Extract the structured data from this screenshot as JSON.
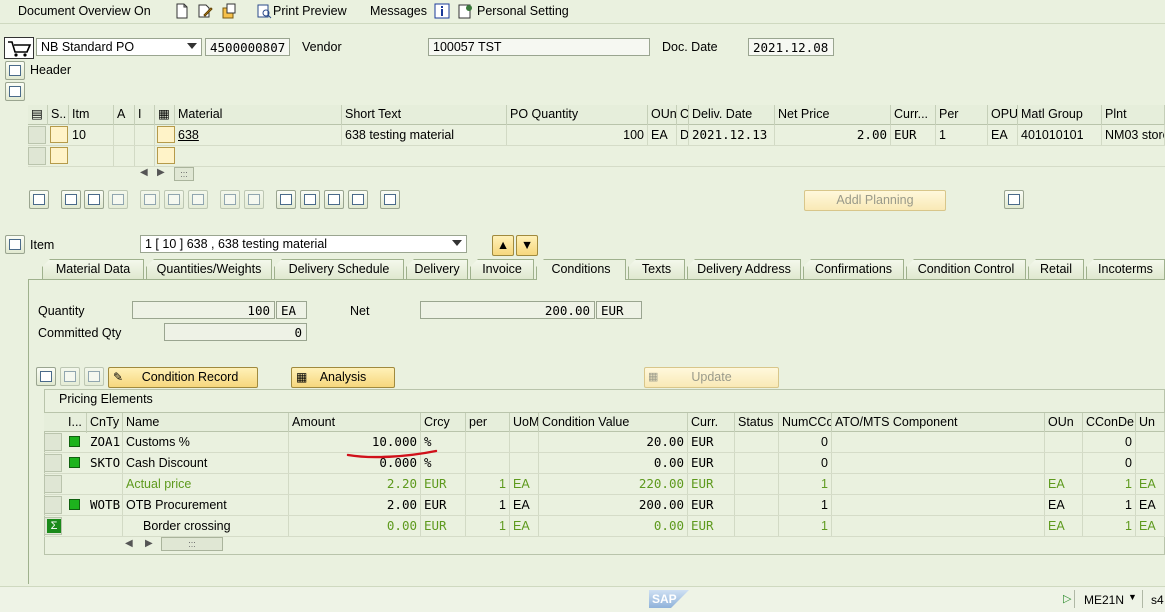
{
  "toolbar": {
    "doc_overview": "Document Overview On",
    "print_preview": "Print Preview",
    "messages": "Messages",
    "personal_setting": "Personal Setting"
  },
  "header": {
    "po_type": "NB Standard PO",
    "po_number": "4500000807",
    "vendor_label": "Vendor",
    "vendor_value": "100057 TST",
    "doc_date_label": "Doc. Date",
    "doc_date_value": "2021.12.08",
    "header_label": "Header"
  },
  "item_grid": {
    "columns": [
      "S..",
      "Itm",
      "A",
      "I",
      "",
      "Material",
      "Short Text",
      "PO Quantity",
      "OUn",
      "C",
      "Deliv. Date",
      "Net Price",
      "Curr...",
      "Per",
      "OPU",
      "Matl Group",
      "Plnt"
    ],
    "row": {
      "itm": "10",
      "material": "638",
      "short_text": "638 testing material",
      "po_quantity": "100",
      "oun": "EA",
      "c": "D",
      "deliv_date": "2021.12.13",
      "net_price": "2.00",
      "curr": "EUR",
      "per": "1",
      "opu": "EA",
      "matl_group": "401010101",
      "plnt": "NM03 store"
    },
    "scroll_glyph": ":::"
  },
  "addl_planning": "Addl Planning",
  "item_section": {
    "label": "Item",
    "selected": "1 [ 10 ] 638 , 638 testing material"
  },
  "tabs": [
    "Material Data",
    "Quantities/Weights",
    "Delivery Schedule",
    "Delivery",
    "Invoice",
    "Conditions",
    "Texts",
    "Delivery Address",
    "Confirmations",
    "Condition Control",
    "Retail",
    "Incoterms"
  ],
  "active_tab": "Conditions",
  "conditions": {
    "quantity_label": "Quantity",
    "quantity_value": "100",
    "quantity_unit": "EA",
    "net_label": "Net",
    "net_value": "200.00",
    "net_currency": "EUR",
    "committed_label": "Committed Qty",
    "committed_value": "0",
    "condition_record_btn": "Condition Record",
    "analysis_btn": "Analysis",
    "update_btn": "Update",
    "pricing_title": "Pricing Elements"
  },
  "pricing_grid": {
    "columns": [
      "I...",
      "CnTy",
      "Name",
      "Amount",
      "Crcy",
      "per",
      "UoM",
      "Condition Value",
      "Curr.",
      "Status",
      "NumCCo",
      "ATO/MTS Component",
      "OUn",
      "CConDe",
      "Un"
    ],
    "rows": [
      {
        "cnty": "ZOA1",
        "name": "Customs %",
        "amount": "10.000",
        "crcy": "%",
        "per": "",
        "uom": "",
        "cond_value": "20.00",
        "curr": "EUR",
        "numcco": "0",
        "oun": "",
        "ccon": "0",
        "un": "",
        "style": "normal"
      },
      {
        "cnty": "SKTO",
        "name": "Cash Discount",
        "amount": "0.000",
        "crcy": "%",
        "per": "",
        "uom": "",
        "cond_value": "0.00",
        "curr": "EUR",
        "numcco": "0",
        "oun": "",
        "ccon": "0",
        "un": "",
        "style": "normal"
      },
      {
        "cnty": "",
        "name": "Actual price",
        "amount": "2.20",
        "crcy": "EUR",
        "per": "1",
        "uom": "EA",
        "cond_value": "220.00",
        "curr": "EUR",
        "numcco": "1",
        "oun": "EA",
        "ccon": "1",
        "un": "EA",
        "style": "green"
      },
      {
        "cnty": "WOTB",
        "name": "OTB Procurement",
        "amount": "2.00",
        "crcy": "EUR",
        "per": "1",
        "uom": "EA",
        "cond_value": "200.00",
        "curr": "EUR",
        "numcco": "1",
        "oun": "EA",
        "ccon": "1",
        "un": "EA",
        "style": "normal"
      },
      {
        "cnty": "",
        "name": "Border crossing",
        "amount": "0.00",
        "crcy": "EUR",
        "per": "1",
        "uom": "EA",
        "cond_value": "0.00",
        "curr": "EUR",
        "numcco": "1",
        "oun": "EA",
        "ccon": "1",
        "un": "EA",
        "style": "sum"
      }
    ]
  },
  "status_bar": {
    "tcode": "ME21N",
    "system": "s4",
    "logo": "SAP"
  },
  "colors": {
    "background": "#eaf1df",
    "green_text": "#5e9a1e",
    "red_underline": "#d0101a",
    "button_yellow": "#f6d77d"
  }
}
